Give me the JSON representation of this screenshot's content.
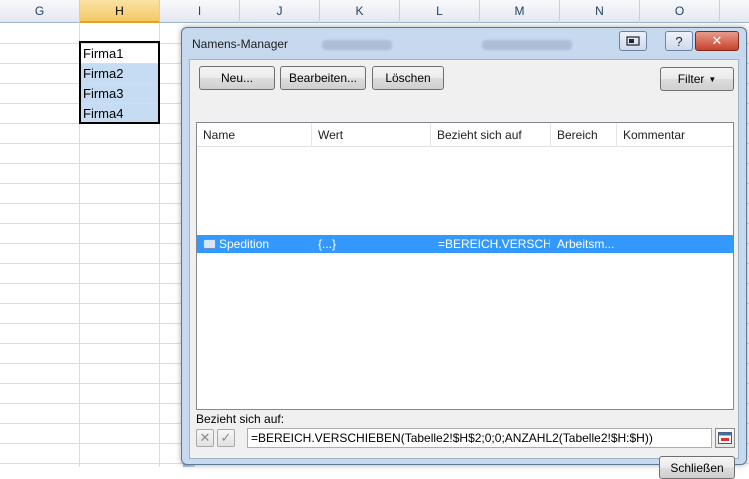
{
  "sheet": {
    "columns": [
      "G",
      "H",
      "I",
      "J",
      "K",
      "L",
      "M",
      "N",
      "O"
    ],
    "selected_column": "H",
    "cells": [
      "Firma1",
      "Firma2",
      "Firma3",
      "Firma4"
    ]
  },
  "dialog": {
    "title": "Namens-Manager",
    "buttons": {
      "new": "Neu...",
      "edit": "Bearbeiten...",
      "delete": "Löschen",
      "filter": "Filter",
      "close": "Schließen"
    },
    "columns": {
      "name": "Name",
      "value": "Wert",
      "refers_to": "Bezieht sich auf",
      "scope": "Bereich",
      "comment": "Kommentar"
    },
    "rows": [
      {
        "name": "Spedition",
        "value": "{...}",
        "refers_to": "=BEREICH.VERSCH...",
        "scope": "Arbeitsm..."
      }
    ],
    "refers_to_label": "Bezieht sich auf:",
    "formula": "=BEREICH.VERSCHIEBEN(Tabelle2!$H$2;0;0;ANZAHL2(Tabelle2!$H:$H))",
    "icons": [
      "restore-icon",
      "help-icon",
      "close-icon",
      "dropdown-arrow-icon",
      "name-tag-icon",
      "cancel-x-icon",
      "checkmark-icon",
      "collapse-range-icon"
    ]
  },
  "colors": {
    "selection": "#3399ff",
    "dialog_frame": "#c7d9ef",
    "cell_highlight": "#c5dcf3"
  }
}
